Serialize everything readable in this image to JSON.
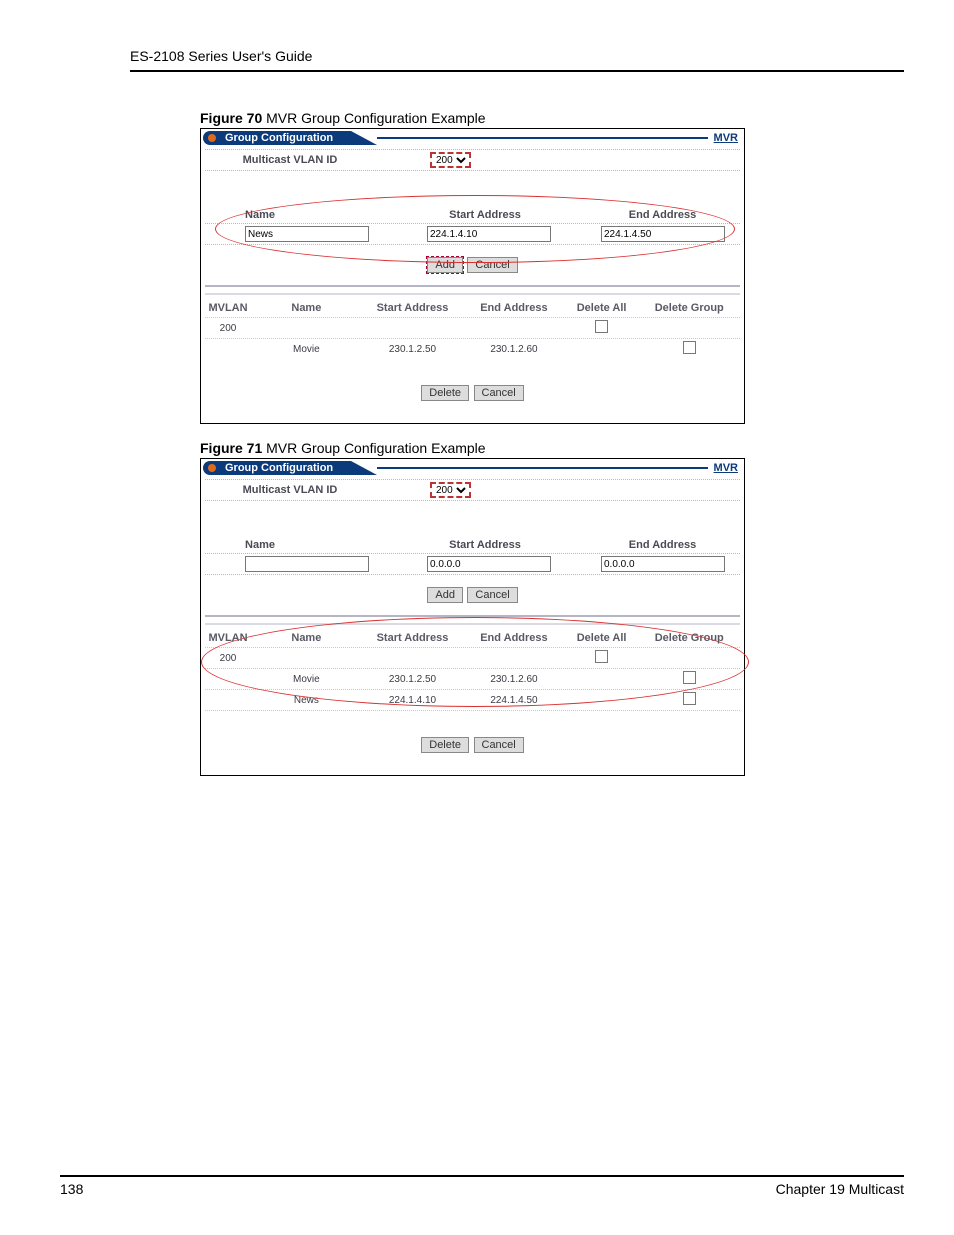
{
  "document": {
    "header": "ES-2108 Series User's Guide",
    "page_number": "138",
    "chapter": "Chapter 19 Multicast"
  },
  "figures": [
    {
      "caption_num": "Figure 70",
      "caption_text": "   MVR Group Configuration Example",
      "bar_title": "Group Configuration",
      "mvr_link": "MVR",
      "multicast_vlan_label": "Multicast VLAN ID",
      "multicast_vlan_value": "200",
      "name_label": "Name",
      "start_address_label": "Start Address",
      "end_address_label": "End Address",
      "name_value": "News",
      "start_address_value": "224.1.4.10",
      "end_address_value": "224.1.4.50",
      "btn_add": "Add",
      "btn_cancel": "Cancel",
      "btn_delete": "Delete",
      "table": {
        "headers": {
          "mvlan": "MVLAN",
          "name": "Name",
          "start": "Start Address",
          "end": "End Address",
          "delall": "Delete All",
          "delgrp": "Delete Group"
        },
        "rows": [
          {
            "mvlan": "200",
            "name": "",
            "start": "",
            "end": "",
            "delall_cb": true,
            "delgrp_cb": false
          },
          {
            "mvlan": "",
            "name": "Movie",
            "start": "230.1.2.50",
            "end": "230.1.2.60",
            "delall_cb": false,
            "delgrp_cb": true
          }
        ]
      }
    },
    {
      "caption_num": "Figure 71",
      "caption_text": "   MVR Group Configuration Example",
      "bar_title": "Group Configuration",
      "mvr_link": "MVR",
      "multicast_vlan_label": "Multicast VLAN ID",
      "multicast_vlan_value": "200",
      "name_label": "Name",
      "start_address_label": "Start Address",
      "end_address_label": "End Address",
      "name_value": "",
      "start_address_value": "0.0.0.0",
      "end_address_value": "0.0.0.0",
      "btn_add": "Add",
      "btn_cancel": "Cancel",
      "btn_delete": "Delete",
      "table": {
        "headers": {
          "mvlan": "MVLAN",
          "name": "Name",
          "start": "Start Address",
          "end": "End Address",
          "delall": "Delete All",
          "delgrp": "Delete Group"
        },
        "rows": [
          {
            "mvlan": "200",
            "name": "",
            "start": "",
            "end": "",
            "delall_cb": true,
            "delgrp_cb": false
          },
          {
            "mvlan": "",
            "name": "Movie",
            "start": "230.1.2.50",
            "end": "230.1.2.60",
            "delall_cb": false,
            "delgrp_cb": true
          },
          {
            "mvlan": "",
            "name": "News",
            "start": "224.1.4.10",
            "end": "224.1.4.50",
            "delall_cb": false,
            "delgrp_cb": true
          }
        ]
      }
    }
  ]
}
